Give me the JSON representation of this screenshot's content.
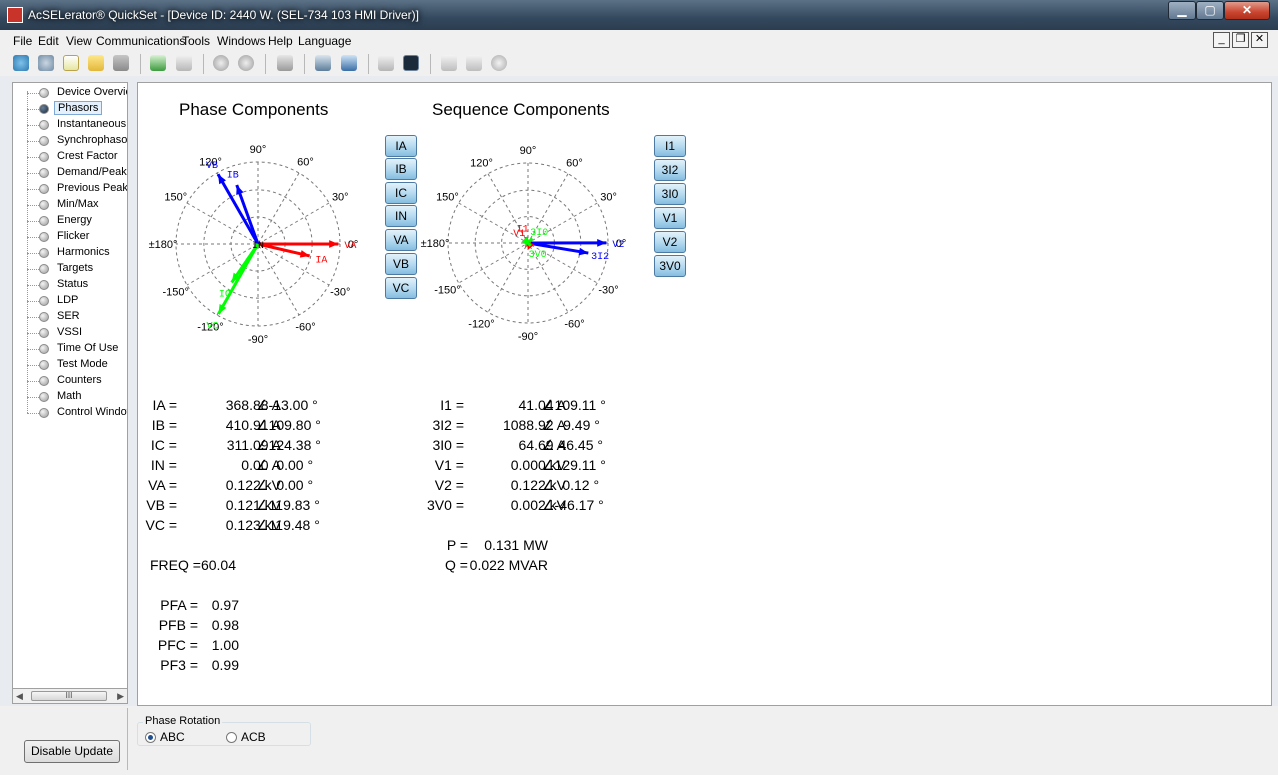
{
  "window": {
    "title": "AcSELerator® QuickSet - [Device ID: 2440 W. (SEL-734 103 HMI Driver)]",
    "min_label": "▁",
    "max_label": "▢",
    "close_label": "✕"
  },
  "menu": [
    "File",
    "Edit",
    "View",
    "Communications",
    "Tools",
    "Windows",
    "Help",
    "Language"
  ],
  "mdi": {
    "min": "_",
    "restore": "❐",
    "close": "✕"
  },
  "toolbar_icons": [
    "home-icon",
    "connect-icon",
    "new-file-icon",
    "open-folder-icon",
    "save-icon",
    "import-icon",
    "export-icon",
    "power-icon",
    "upload-icon",
    "tools-icon",
    "device-icon",
    "report-icon",
    "meter-icon",
    "terminal-icon",
    "edit-icon",
    "list-icon",
    "settings-icon"
  ],
  "tree": {
    "items": [
      "Device Overview",
      "Phasors",
      "Instantaneous",
      "Synchrophasors",
      "Crest Factor",
      "Demand/Peak",
      "Previous Peak",
      "Min/Max",
      "Energy",
      "Flicker",
      "Harmonics",
      "Targets",
      "Status",
      "LDP",
      "SER",
      "VSSI",
      "Time Of Use",
      "Test Mode",
      "Counters",
      "Math",
      "Control Window"
    ],
    "selected": "Phasors",
    "scroll_thumb": "III"
  },
  "phase": {
    "title": "Phase Components",
    "buttons": [
      "IA",
      "IB",
      "IC",
      "IN",
      "VA",
      "VB",
      "VC"
    ],
    "angle_labels": {
      "a90": "90°",
      "a60": "60°",
      "a30": "30°",
      "a0": "0°",
      "a-30": "-30°",
      "a-60": "-60°",
      "a-90": "-90°",
      "a-120": "-120°",
      "a-150": "-150°",
      "a180": "±180°",
      "a150": "150°",
      "a120": "120°"
    },
    "phasors": [
      {
        "name": "VA",
        "magnitude": 1.0,
        "angle": 0.0,
        "color": "#ff0000"
      },
      {
        "name": "IA",
        "magnitude": 0.66,
        "angle": -13.0,
        "color": "#ff0000"
      },
      {
        "name": "VB",
        "magnitude": 1.0,
        "angle": 119.83,
        "color": "#0000ff"
      },
      {
        "name": "IB",
        "magnitude": 0.78,
        "angle": 109.8,
        "color": "#0000ff"
      },
      {
        "name": "VC",
        "magnitude": 1.0,
        "angle": -119.48,
        "color": "#00ff00"
      },
      {
        "name": "IC",
        "magnitude": 0.58,
        "angle": -124.38,
        "color": "#00ff00"
      }
    ],
    "origin_label": "IN",
    "readings": [
      {
        "label": "IA =",
        "value": "368.88 A",
        "angle": "∠-13.00 °"
      },
      {
        "label": "IB =",
        "value": "410.91 A",
        "angle": "∠109.80 °"
      },
      {
        "label": "IC =",
        "value": "311.09 A",
        "angle": "∠124.38 °"
      },
      {
        "label": "IN =",
        "value": "0.00 A",
        "angle": "∠  0.00 °"
      },
      {
        "label": "VA =",
        "value": "0.122 kV",
        "angle": "∠  0.00 °"
      },
      {
        "label": "VB =",
        "value": "0.121 kV",
        "angle": "∠119.83 °"
      },
      {
        "label": "VC =",
        "value": "0.123 kV",
        "angle": "∠119.48 °"
      }
    ],
    "freq": "FREQ =60.04",
    "pf": [
      {
        "label": "PFA =",
        "value": "0.97"
      },
      {
        "label": "PFB =",
        "value": "0.98"
      },
      {
        "label": "PFC =",
        "value": "1.00"
      },
      {
        "label": "PF3 =",
        "value": "0.99"
      }
    ]
  },
  "sequence": {
    "title": "Sequence Components",
    "buttons": [
      "I1",
      "3I2",
      "3I0",
      "V1",
      "V2",
      "3V0"
    ],
    "angle_labels": {
      "a90": "90°",
      "a60": "60°",
      "a30": "30°",
      "a0": "0°",
      "a-30": "-30°",
      "a-60": "-60°",
      "a-90": "-90°",
      "a-120": "-120°",
      "a-150": "-150°",
      "a180": "±180°",
      "a150": "150°",
      "a120": "120°"
    },
    "phasors": [
      {
        "name": "V2",
        "magnitude": 1.0,
        "angle": 0.12,
        "color": "#0000ff",
        "label": "V2"
      },
      {
        "name": "3I2",
        "magnitude": 0.78,
        "angle": -9.49,
        "color": "#0000ff",
        "label": "3I2"
      },
      {
        "name": "I1",
        "magnitude": 0.08,
        "angle": 109.11,
        "color": "#ff0000",
        "label": "I1"
      },
      {
        "name": "3I0",
        "magnitude": 0.08,
        "angle": 46.45,
        "color": "#00ff00",
        "label": "3I0"
      },
      {
        "name": "V1",
        "magnitude": 0.05,
        "angle": 129.11,
        "color": "#ff0000",
        "label": "V1"
      },
      {
        "name": "3V0",
        "magnitude": 0.05,
        "angle": -46.17,
        "color": "#00ff00",
        "label": "3V0"
      }
    ],
    "readings": [
      {
        "label": "I1 =",
        "value": "41.04 A",
        "angle": "∠109.11 °"
      },
      {
        "label": "3I2 =",
        "value": "1088.92 A",
        "angle": "∠ -9.49 °"
      },
      {
        "label": "3I0 =",
        "value": "64.69 A",
        "angle": "∠ 46.45 °"
      },
      {
        "label": "V1 =",
        "value": "0.000 kV",
        "angle": "∠129.11 °"
      },
      {
        "label": "V2 =",
        "value": "0.122 kV",
        "angle": "∠  0.12 °"
      },
      {
        "label": "3V0 =",
        "value": "0.002 kV",
        "angle": "∠-46.17 °"
      }
    ],
    "power": [
      {
        "label": "P =",
        "value": "0.131 MW"
      },
      {
        "label": "Q =",
        "value": "0.022 MVAR"
      }
    ]
  },
  "bottom": {
    "disable_update": "Disable Update",
    "phase_rotation_title": "Phase Rotation",
    "abc": "ABC",
    "acb": "ACB",
    "selected": "ABC"
  }
}
